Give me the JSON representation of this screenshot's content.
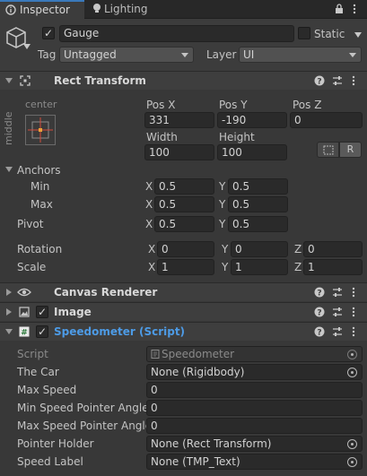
{
  "tabs": {
    "inspector": "Inspector",
    "lighting": "Lighting"
  },
  "object": {
    "name": "Gauge",
    "static_label": "Static",
    "tag_label": "Tag",
    "tag_value": "Untagged",
    "layer_label": "Layer",
    "layer_value": "UI"
  },
  "rect_transform": {
    "title": "Rect Transform",
    "anchor_preset_h": "center",
    "anchor_preset_v": "middle",
    "pos_x_label": "Pos X",
    "pos_y_label": "Pos Y",
    "pos_z_label": "Pos Z",
    "pos_x": "331",
    "pos_y": "-190",
    "pos_z": "0",
    "width_label": "Width",
    "height_label": "Height",
    "width": "100",
    "height": "100",
    "raw_button": "R",
    "anchors_label": "Anchors",
    "min_label": "Min",
    "max_label": "Max",
    "min_x": "0.5",
    "min_y": "0.5",
    "max_x": "0.5",
    "max_y": "0.5",
    "pivot_label": "Pivot",
    "pivot_x": "0.5",
    "pivot_y": "0.5",
    "rotation_label": "Rotation",
    "rot_x": "0",
    "rot_y": "0",
    "rot_z": "0",
    "scale_label": "Scale",
    "scale_x": "1",
    "scale_y": "1",
    "scale_z": "1",
    "axis_x": "X",
    "axis_y": "Y",
    "axis_z": "Z"
  },
  "canvas_renderer": {
    "title": "Canvas Renderer"
  },
  "image": {
    "title": "Image"
  },
  "script": {
    "title": "Speedometer (Script)",
    "title_color": "#4d9be6",
    "fields": [
      {
        "label": "Script",
        "value": "Speedometer"
      },
      {
        "label": "The Car",
        "value": "None (Rigidbody)"
      },
      {
        "label": "Max Speed",
        "value": "0"
      },
      {
        "label": "Min Speed Pointer Angle",
        "value": "0"
      },
      {
        "label": "Max Speed Pointer Angle",
        "value": "0"
      },
      {
        "label": "Pointer Holder",
        "value": "None (Rect Transform)"
      },
      {
        "label": "Speed Label",
        "value": "None (TMP_Text)"
      }
    ]
  },
  "icons": [
    "inspector-icon",
    "lighting-icon",
    "lock-icon",
    "menu-icon",
    "gameobject-cube-icon",
    "rect-transform-icon",
    "help-icon",
    "preset-icon",
    "kebab-menu-icon",
    "eye-icon",
    "image-icon",
    "script-icon",
    "object-picker-icon",
    "blueprint-mode-icon"
  ]
}
